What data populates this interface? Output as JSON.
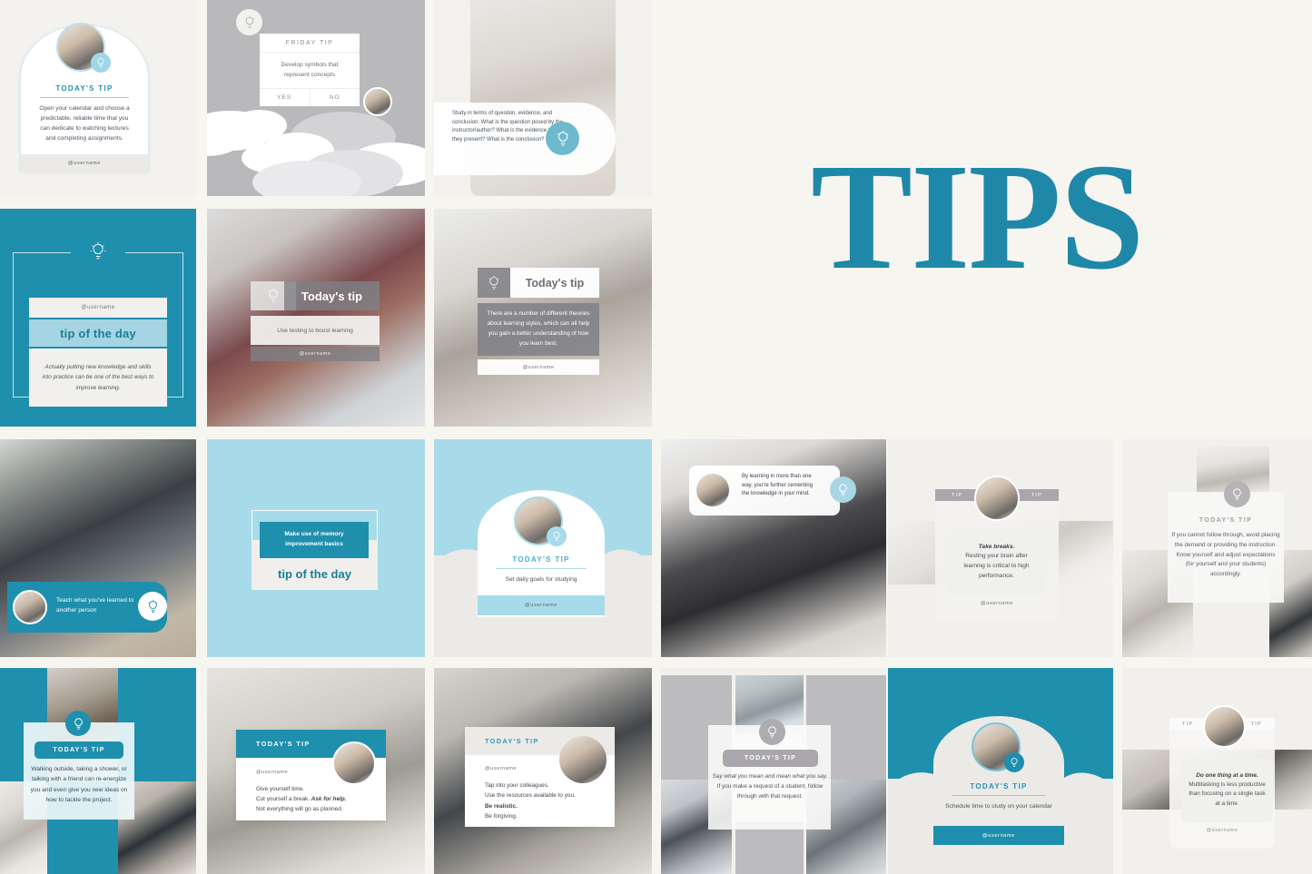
{
  "page": {
    "title": "TIPS",
    "background_color": "#f7f5f0",
    "accent_teal": "#1f8fae",
    "accent_light_blue": "#9ed7e8",
    "accent_gray": "#b9b9bc",
    "username": "@username"
  },
  "tiles": [
    {
      "id": "tile-arch-calendar",
      "style": "arch-white-card",
      "heading": "TODAY'S TIP",
      "body": "Open your calendar and choose a predictable, reliable time that you can dedicate to watching lectures and completing assignments.",
      "username": "@username",
      "icon": "lightbulb-icon"
    },
    {
      "id": "tile-friday-tip-clouds",
      "style": "gray-clouds-dialog",
      "heading": "FRIDAY TIP",
      "body": "Develop symbols that represent concepts",
      "buttons": [
        "YES",
        "NO"
      ],
      "icon": "lightbulb-icon"
    },
    {
      "id": "tile-study-question",
      "style": "photo-overlay-bubble",
      "body": "Study in terms of question, evidence, and conclusion: What is the question posed by the instructor/author? What is the evidence that they present? What is the conclusion?",
      "icon": "lightbulb-icon"
    },
    {
      "id": "tile-teal-tip-of-day",
      "style": "teal-framed-card",
      "username": "@username",
      "heading": "tip of the day",
      "body": "Actually putting new knowledge and skills into practice can be one of the best ways to improve learning.",
      "icon": "lightbulb-icon"
    },
    {
      "id": "tile-todays-tip-testing",
      "style": "photo-gray-banner",
      "heading": "Today's tip",
      "body": "Use testing to boost learning",
      "username": "@username",
      "icon": "lightbulb-icon"
    },
    {
      "id": "tile-todays-tip-learning-styles",
      "style": "photo-gray-banner",
      "heading": "Today's tip",
      "body": "There are a number of different theories about learning styles, which can all help you gain a better understanding of how you learn best.",
      "username": "@username",
      "icon": "lightbulb-icon"
    },
    {
      "id": "tile-teach-another",
      "style": "photo-teal-pill",
      "body": "Teach what you've learned to another person",
      "icon": "lightbulb-icon",
      "avatar": "avatar"
    },
    {
      "id": "tile-memory-basics",
      "style": "skyblue-framed-card",
      "heading": "Make use of memory improvement basics",
      "body": "tip of the day"
    },
    {
      "id": "tile-arch-daily-goals",
      "style": "arch-skyblue",
      "heading": "TODAY'S TIP",
      "body": "Set daily goals for studying",
      "username": "@username",
      "icon": "lightbulb-icon"
    },
    {
      "id": "tile-learning-more-than-one-way",
      "style": "photo-chat-bubble",
      "body": "By learning in more than one way, you're further cementing the knowledge in your mind.",
      "icon": "lightbulb-icon",
      "avatar": "avatar"
    },
    {
      "id": "tile-take-breaks",
      "style": "tip-tabs-card",
      "tabs": [
        "TIP",
        "TIP"
      ],
      "body_bold": "Take breaks.",
      "body": "Resting your brain after learning is critical to high performance.",
      "username": "@username",
      "avatar": "avatar"
    },
    {
      "id": "tile-follow-through",
      "style": "collage-overlay",
      "heading": "TODAY'S TIP",
      "body": "If you cannot follow through, avoid placing the demand or providing the instruction. Know yourself and adjust expectations (for yourself and your students) accordingly.",
      "icon": "lightbulb-icon"
    },
    {
      "id": "tile-walking-outside",
      "style": "teal-collage",
      "heading": "TODAY'S TIP",
      "body": "Walking outside, taking a shower, or talking with a friend can re-energize you and even give you new ideas on how to tackle the project.",
      "icon": "lightbulb-icon"
    },
    {
      "id": "tile-give-yourself-time",
      "style": "photo-white-card-teal-header",
      "heading": "TODAY'S TIP",
      "username": "@username",
      "line1": "Give yourself time.",
      "line2a": "Cut yourself a break. ",
      "line2b": "Ask for help.",
      "line3": "Not everything will go as planned.",
      "avatar": "avatar"
    },
    {
      "id": "tile-tap-colleagues",
      "style": "photo-white-card-gray-header",
      "heading": "TODAY'S TIP",
      "username": "@username",
      "line1": "Tap into your colleagues.",
      "line2": "Use the resources available to you.",
      "line3": "Be realistic.",
      "line4": "Be forgiving.",
      "avatar": "avatar"
    },
    {
      "id": "tile-say-what-you-mean",
      "style": "gray-collage-overlay",
      "heading": "TODAY'S TIP",
      "body_italic": "Say what you mean and mean what you say.",
      "body": "If you make a request of a student, follow through with that request.",
      "icon": "lightbulb-icon"
    },
    {
      "id": "tile-arch-schedule-study",
      "style": "arch-teal",
      "heading": "TODAY'S TIP",
      "body": "Schedule time to study on your calendar",
      "username": "@username",
      "icon": "lightbulb-icon"
    },
    {
      "id": "tile-one-thing-at-a-time",
      "style": "tip-tabs-card",
      "tabs": [
        "TIP",
        "TIP"
      ],
      "body_bold": "Do one thing at a time.",
      "body": "Multitasking is less productive than focusing on a single task at a time.",
      "username": "@username",
      "avatar": "avatar"
    }
  ]
}
